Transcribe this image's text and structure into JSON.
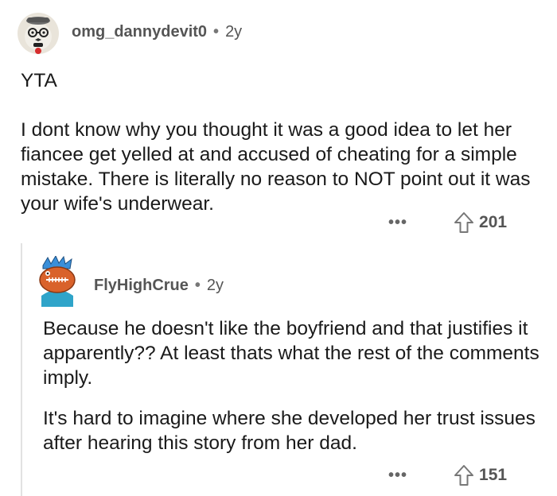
{
  "comment": {
    "author": "omg_dannydevit0",
    "separator": "•",
    "age": "2y",
    "verdict": "YTA",
    "body": "I dont know why you thought it was a good idea to let her fiancee get yelled at and accused of cheating for a simple mistake. There is literally no reason to NOT point out it was your wife's underwear.",
    "more_label": "•••",
    "upvotes": "201",
    "avatar_icon": "cat-with-glasses-avatar",
    "vote_icon": "upvote-arrow-icon"
  },
  "reply": {
    "author": "FlyHighCrue",
    "separator": "•",
    "age": "2y",
    "paragraph_1": "Because he doesn't like the boyfriend and that justifies it apparently?? At least thats what the rest of the comments imply.",
    "paragraph_2": "It's hard to imagine where she developed her trust issues after hearing this story from her dad.",
    "more_label": "•••",
    "upvotes": "151",
    "avatar_icon": "snoo-football-avatar",
    "vote_icon": "upvote-arrow-icon"
  },
  "colors": {
    "text": "#1a1a1a",
    "meta": "#555555",
    "thread_line": "#e2e2e2"
  }
}
